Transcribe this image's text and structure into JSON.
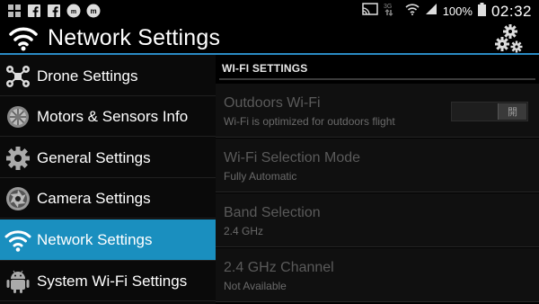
{
  "status_bar": {
    "left_icons": [
      "gallery-icon",
      "facebook-icon",
      "facebook-icon",
      "messenger-icon",
      "app-icon"
    ],
    "signal_type": "3G",
    "battery_percent": "100%",
    "time": "02:32"
  },
  "action_bar": {
    "icon": "wifi-icon",
    "title": "Network Settings",
    "settings_icon": "gears-icon"
  },
  "sidebar": {
    "items": [
      {
        "label": "Drone Settings",
        "icon": "drone-icon"
      },
      {
        "label": "Motors & Sensors Info",
        "icon": "motor-icon"
      },
      {
        "label": "General Settings",
        "icon": "gear-icon"
      },
      {
        "label": "Camera Settings",
        "icon": "camera-aperture-icon"
      },
      {
        "label": "Network Settings",
        "icon": "wifi-icon",
        "active": true
      },
      {
        "label": "System Wi-Fi Settings",
        "icon": "android-icon"
      }
    ]
  },
  "main": {
    "section_title": "WI-FI SETTINGS",
    "preferences": [
      {
        "title": "Outdoors Wi-Fi",
        "summary": "Wi-Fi is optimized for outdoors flight",
        "toggle_label": "開"
      },
      {
        "title": "Wi-Fi Selection Mode",
        "summary": "Fully Automatic"
      },
      {
        "title": "Band Selection",
        "summary": "2.4 GHz"
      },
      {
        "title": "2.4 GHz Channel",
        "summary": "Not Available"
      }
    ]
  },
  "colors": {
    "accent": "#1a8fbf",
    "divider": "#2a8bc4",
    "disabled_text": "#5a5a5a"
  }
}
